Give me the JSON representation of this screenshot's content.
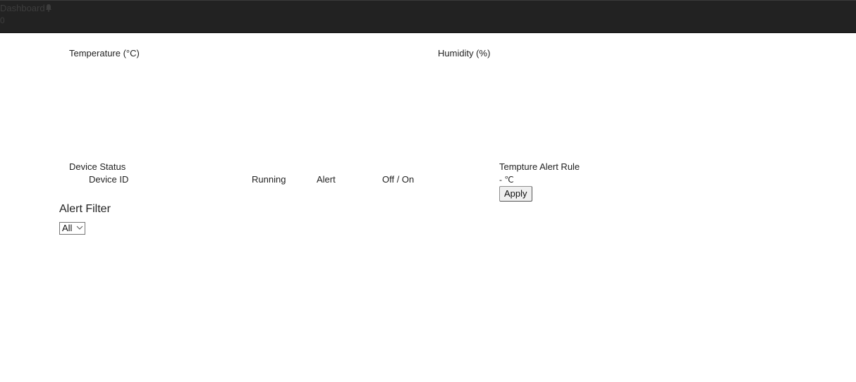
{
  "header": {
    "title": "Dashboard",
    "notification_count": "0",
    "bg_color": "#222222"
  },
  "charts": {
    "temperature_title": "Temperature (°C)",
    "humidity_title": "Humidity (%)"
  },
  "device_status": {
    "title": "Device Status",
    "columns": [
      "Device ID",
      "Running",
      "Alert",
      "Off / On"
    ]
  },
  "alert_rule": {
    "title": "Tempture Alert Rule",
    "unit_value": "- ℃",
    "apply_label": "Apply"
  },
  "alert_filter": {
    "title": "Alert Filter",
    "selected": "All"
  }
}
